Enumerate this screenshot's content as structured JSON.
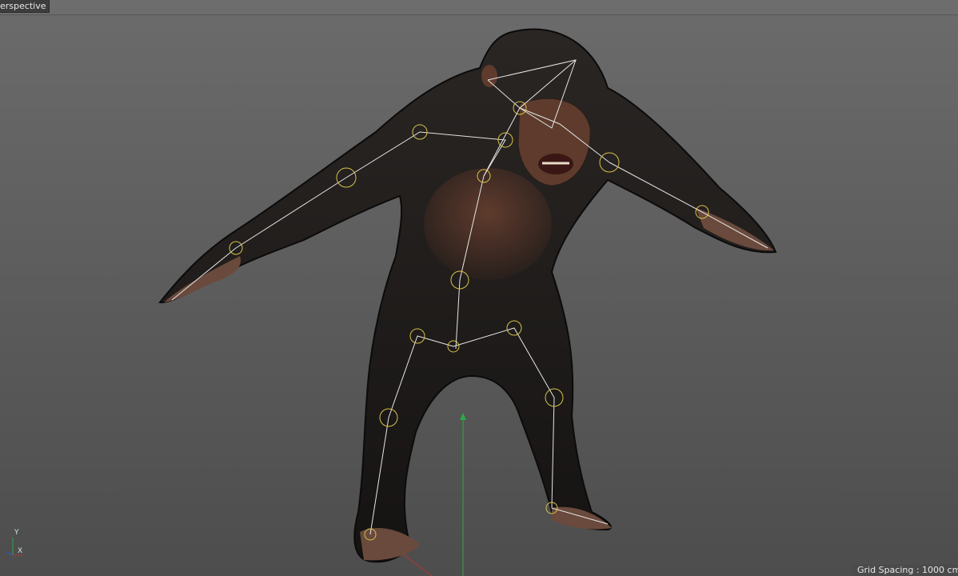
{
  "viewport": {
    "label": "erspective",
    "grid_spacing": "Grid Spacing : 1000 cm",
    "axis_labels": {
      "y": "Y",
      "x": "X"
    },
    "subject": "chimpanzee-with-skeleton-rig",
    "colors": {
      "background_top": "#6b6b6b",
      "background_bottom": "#4d4d4d",
      "fur": "#1c1a19",
      "skin": "#5e3b2c",
      "bone_lines": "#e6e6e6",
      "joint_circles": "#d6c24a",
      "world_y_axis": "#2fa844",
      "world_x_axis": "#b33333"
    }
  }
}
